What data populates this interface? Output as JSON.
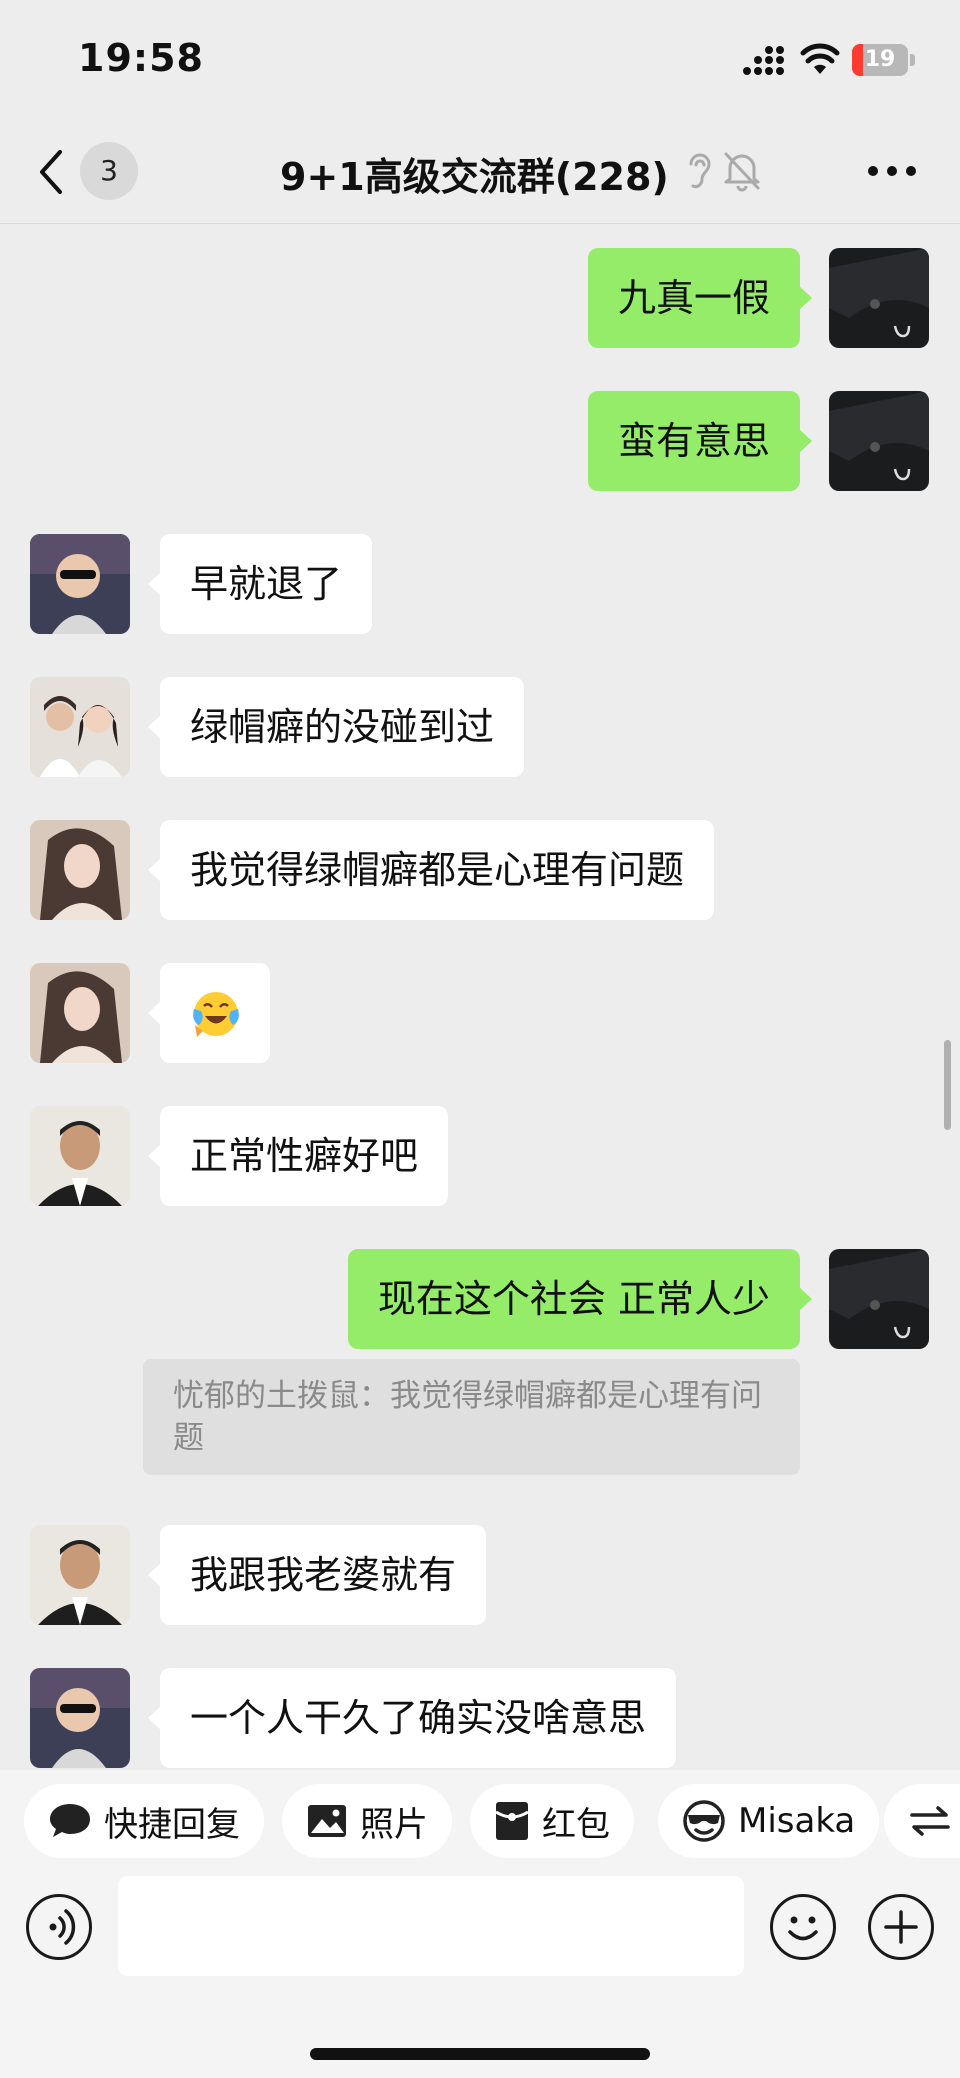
{
  "status_bar": {
    "time": "19:58",
    "battery": "19",
    "battery_level": 0.19,
    "battery_color": "#ff3b30"
  },
  "header": {
    "back_badge": "3",
    "title": "9+1高级交流群(228)"
  },
  "messages": [
    {
      "side": "out",
      "text": "九真一假"
    },
    {
      "side": "out",
      "text": "蛮有意思"
    },
    {
      "side": "in",
      "text": "早就退了",
      "avatar": "baby-avatar"
    },
    {
      "side": "in",
      "text": "绿帽癖的没碰到过",
      "avatar": "couple-avatar"
    },
    {
      "side": "in",
      "text": "我觉得绿帽癖都是心理有问题",
      "avatar": "woman-avatar"
    },
    {
      "side": "in",
      "text": "",
      "emoji": "face-with-tears-of-joy",
      "avatar": "woman-avatar"
    },
    {
      "side": "in",
      "text": "正常性癖好吧",
      "avatar": "man-suit-avatar"
    },
    {
      "side": "out",
      "text": "现在这个社会 正常人少"
    },
    {
      "side": "in",
      "text": "我跟我老婆就有",
      "avatar": "man-suit-avatar"
    },
    {
      "side": "in",
      "text": "一个人干久了确实没啥意思",
      "avatar": "baby-avatar"
    }
  ],
  "quote": {
    "text": "忧郁的土拨鼠：我觉得绿帽癖都是心理有问题"
  },
  "quickbar": {
    "quick_reply": "快捷回复",
    "photo": "照片",
    "red_packet": "红包",
    "misaka": "Misaka"
  },
  "input": {
    "value": ""
  },
  "colors": {
    "out_bubble": "#95ec69",
    "in_bubble": "#ffffff",
    "background": "#ededed"
  }
}
